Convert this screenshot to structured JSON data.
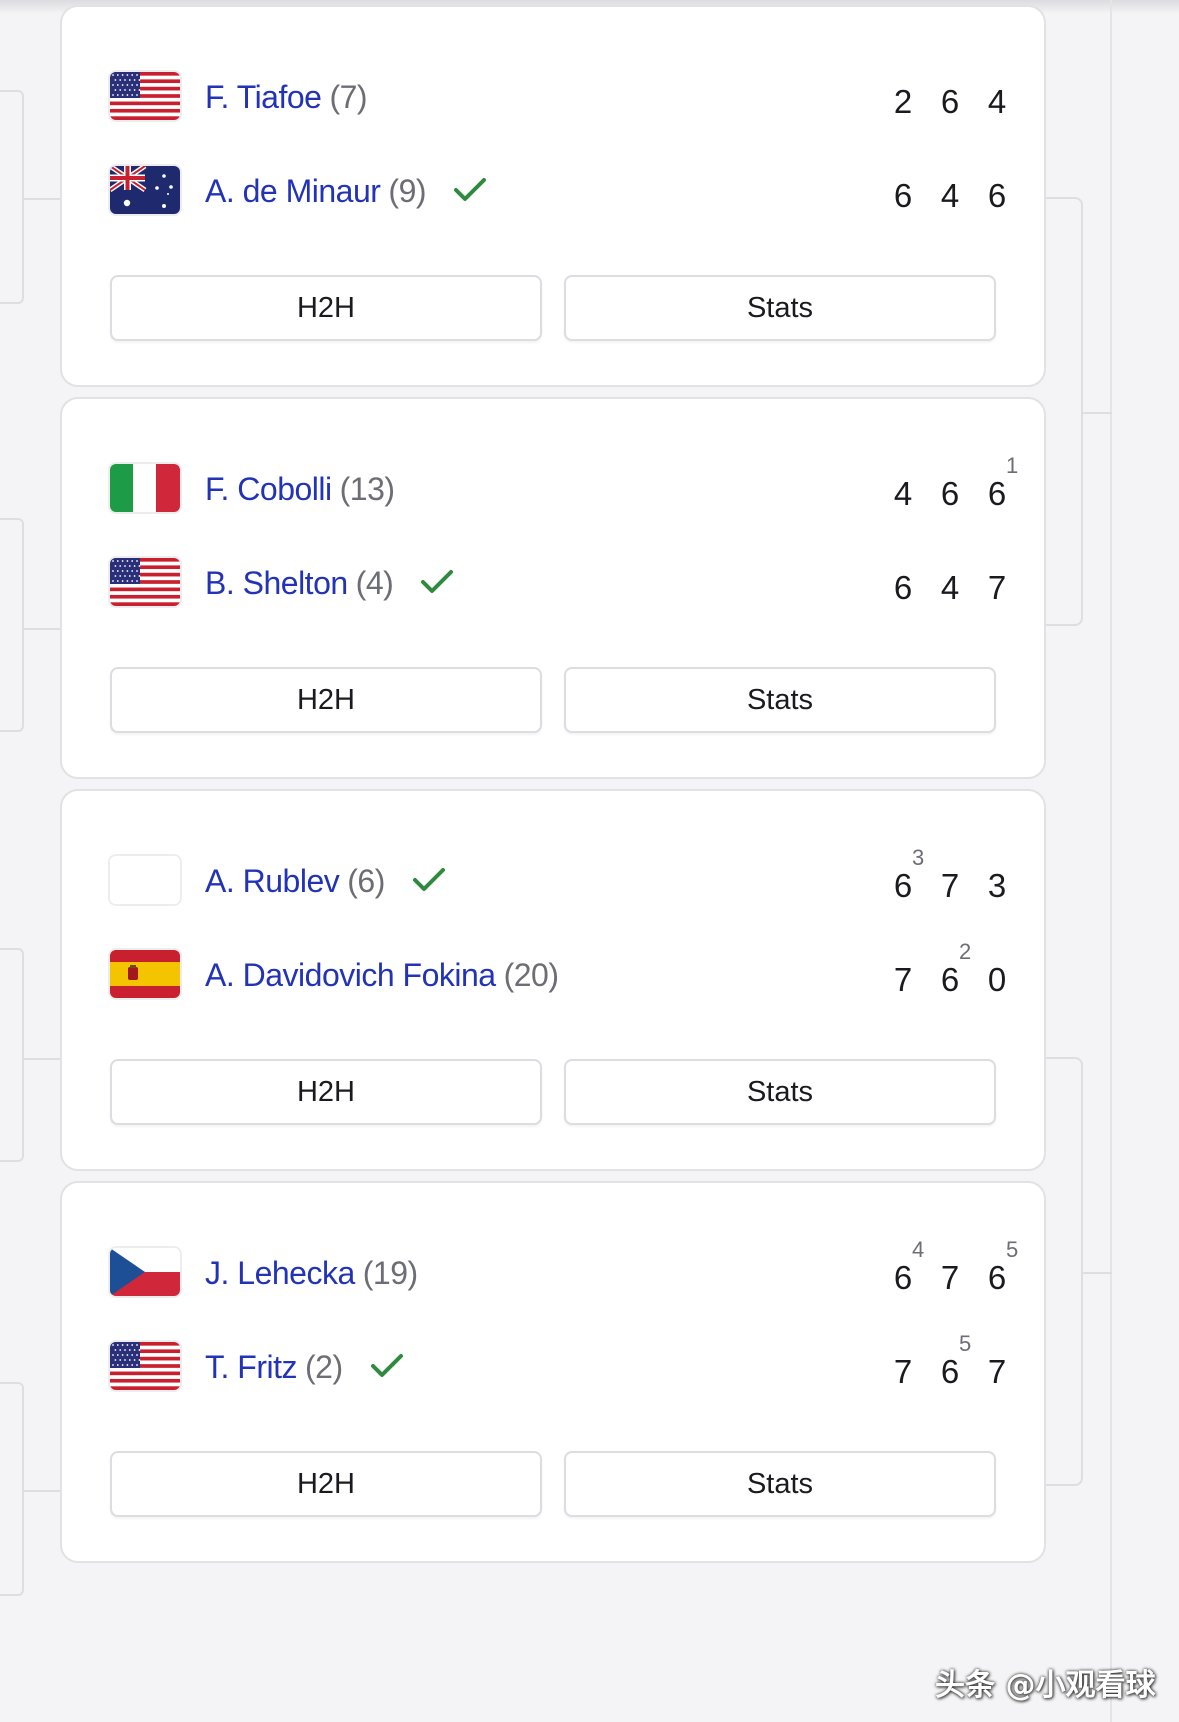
{
  "matches": [
    {
      "players": [
        {
          "name": "F. Tiafoe",
          "seed": "(7)",
          "flag": "usa-flag",
          "winner": false,
          "sets": [
            {
              "games": "2",
              "tb": ""
            },
            {
              "games": "6",
              "tb": ""
            },
            {
              "games": "4",
              "tb": ""
            }
          ]
        },
        {
          "name": "A. de Minaur",
          "seed": "(9)",
          "flag": "australia-flag",
          "winner": true,
          "sets": [
            {
              "games": "6",
              "tb": ""
            },
            {
              "games": "4",
              "tb": ""
            },
            {
              "games": "6",
              "tb": ""
            }
          ]
        }
      ],
      "h2h_label": "H2H",
      "stats_label": "Stats"
    },
    {
      "players": [
        {
          "name": "F. Cobolli",
          "seed": "(13)",
          "flag": "italy-flag",
          "winner": false,
          "sets": [
            {
              "games": "4",
              "tb": ""
            },
            {
              "games": "6",
              "tb": ""
            },
            {
              "games": "6",
              "tb": "1"
            }
          ]
        },
        {
          "name": "B. Shelton",
          "seed": "(4)",
          "flag": "usa-flag",
          "winner": true,
          "sets": [
            {
              "games": "6",
              "tb": ""
            },
            {
              "games": "4",
              "tb": ""
            },
            {
              "games": "7",
              "tb": ""
            }
          ]
        }
      ],
      "h2h_label": "H2H",
      "stats_label": "Stats"
    },
    {
      "players": [
        {
          "name": "A. Rublev",
          "seed": "(6)",
          "flag": "blank-flag",
          "winner": true,
          "sets": [
            {
              "games": "6",
              "tb": "3"
            },
            {
              "games": "7",
              "tb": ""
            },
            {
              "games": "3",
              "tb": ""
            }
          ]
        },
        {
          "name": "A. Davidovich Fokina",
          "seed": "(20)",
          "flag": "spain-flag",
          "winner": false,
          "sets": [
            {
              "games": "7",
              "tb": ""
            },
            {
              "games": "6",
              "tb": "2"
            },
            {
              "games": "0",
              "tb": ""
            }
          ]
        }
      ],
      "h2h_label": "H2H",
      "stats_label": "Stats"
    },
    {
      "players": [
        {
          "name": "J. Lehecka",
          "seed": "(19)",
          "flag": "czech-flag",
          "winner": false,
          "sets": [
            {
              "games": "6",
              "tb": "4"
            },
            {
              "games": "7",
              "tb": ""
            },
            {
              "games": "6",
              "tb": "5"
            }
          ]
        },
        {
          "name": "T. Fritz",
          "seed": "(2)",
          "flag": "usa-flag",
          "winner": true,
          "sets": [
            {
              "games": "7",
              "tb": ""
            },
            {
              "games": "6",
              "tb": "5"
            },
            {
              "games": "7",
              "tb": ""
            }
          ]
        }
      ],
      "h2h_label": "H2H",
      "stats_label": "Stats"
    }
  ],
  "winner_mark_icon": "check-icon",
  "colors": {
    "player_name": "#2233b8",
    "seed": "#6d6d75",
    "check": "#2e8b3e",
    "card_border": "#e1e1e6"
  },
  "watermark": "头条 @小观看球"
}
